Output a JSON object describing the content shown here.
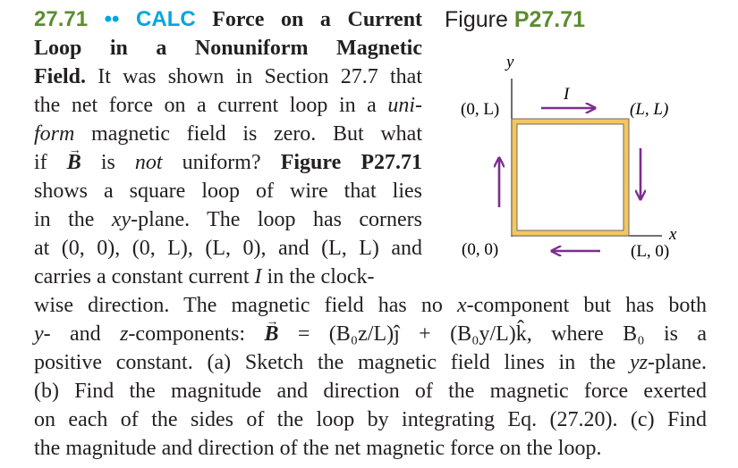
{
  "problem": {
    "number": "27.71",
    "difficulty": "••",
    "tag": "CALC",
    "title": "Force on a Current Loop in a Nonuniform Magnetic Field."
  },
  "lines": {
    "l1_title_a": "Force on a Current",
    "l2_title_b": "Loop in a Nonuniform Magnetic",
    "l3_title_c": "Field.",
    "l3_text": " It was shown in Section 27.7 that",
    "l4_text": "the net force on a current loop in a ",
    "l4_italic": "uni-",
    "l5_italic": "form",
    "l5_text": " magnetic field is zero. But what",
    "l6_a": "if ",
    "l6_vec": "B",
    "l6_b": " is ",
    "l6_italic": "not",
    "l6_c": " uniform? ",
    "l6_bold": "Figure P27.71",
    "l7_text": "shows a square loop of wire that lies",
    "l8_a": "in the ",
    "l8_italic": "xy",
    "l8_b": "-plane. The loop has corners",
    "l9_text": "at (0, 0), (0, L), (L, 0), and (L, L) and",
    "l10_a": "carries a constant current ",
    "l10_italic": "I",
    "l10_b": " in the clock-",
    "l11_a": "wise direction. The magnetic field has no ",
    "l11_italic": "x",
    "l11_b": "-component but has both",
    "l12_a_italic": "y",
    "l12_b": "- and ",
    "l12_c_italic": "z",
    "l12_d": "-components: ",
    "l12_vec": "B",
    "l12_eq": " = (B₀z/L)ĵ + (B₀y/L)k̂, where B₀ is a",
    "l13_a": "positive constant. (a) Sketch the magnetic field lines in the ",
    "l13_italic": "yz",
    "l13_b": "-plane.",
    "l14_text": "(b) Find the magnitude and direction of the magnetic force exerted",
    "l15_text": "on each of the sides of the loop by integrating Eq. (27.20). (c) Find",
    "l16_text": "the magnitude and direction of the net magnetic force on the loop."
  },
  "figure": {
    "label": "Figure",
    "number": "P27.71",
    "axis_y_label": "y",
    "axis_x_label": "x",
    "current_label": "I",
    "corner_00": "(0, 0)",
    "corner_0L": "(0, L)",
    "corner_L0": "(L, 0)",
    "corner_LL": "(L, L)",
    "colors": {
      "loop": "#f5c65e",
      "loop_edge": "#6b6b6b",
      "arrow": "#7b2d8e",
      "axis": "#231f20"
    }
  },
  "colors": {
    "problem_number": "#5e8c31",
    "calc_tag": "#00a6e0",
    "text": "#231f20"
  }
}
